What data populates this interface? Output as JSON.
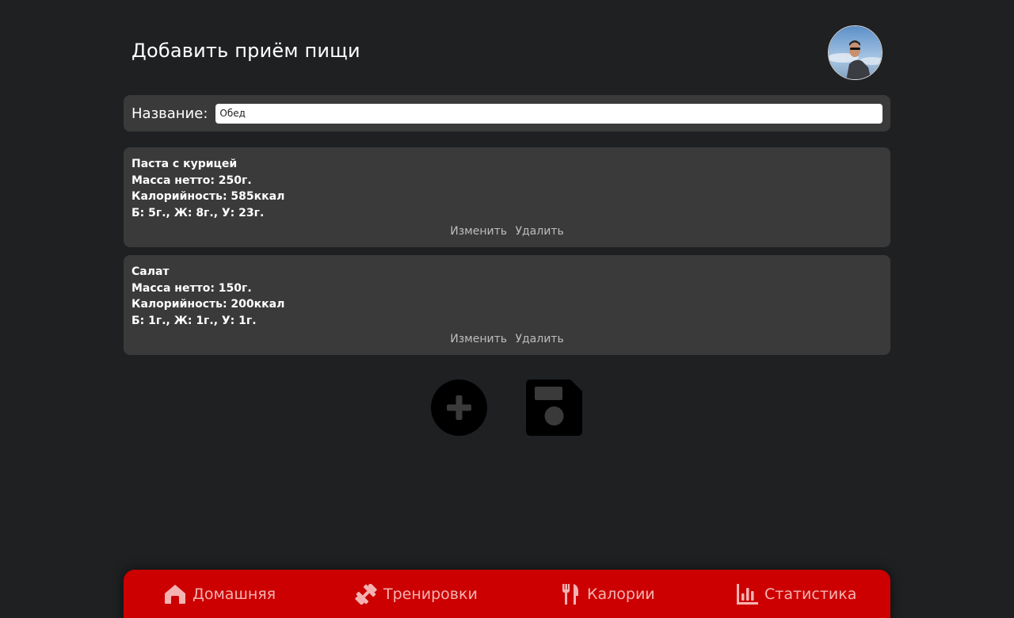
{
  "header": {
    "title": "Добавить приём пищи"
  },
  "name_field": {
    "label": "Название:",
    "value": "Обед"
  },
  "items": [
    {
      "name": "Паста с курицей",
      "mass": "Масса нетто: 250г.",
      "calories": "Калорийность: 585ккал",
      "macros": "Б: 5г., Ж: 8г., У: 23г.",
      "edit_label": "Изменить",
      "delete_label": "Удалить"
    },
    {
      "name": "Салат",
      "mass": "Масса нетто: 150г.",
      "calories": "Калорийность: 200ккал",
      "macros": "Б: 1г., Ж: 1г., У: 1г.",
      "edit_label": "Изменить",
      "delete_label": "Удалить"
    }
  ],
  "actions": {
    "add_icon": "plus-circle-icon",
    "save_icon": "floppy-disk-icon"
  },
  "nav": [
    {
      "label": "Домашняя",
      "icon": "home-icon"
    },
    {
      "label": "Тренировки",
      "icon": "dumbbell-icon"
    },
    {
      "label": "Калории",
      "icon": "fork-knife-icon"
    },
    {
      "label": "Статистика",
      "icon": "bar-chart-icon"
    }
  ],
  "colors": {
    "background": "#1e2022",
    "card": "#3a3a3a",
    "nav_bar": "#cc0000",
    "nav_text": "#f4b3b3",
    "action_link": "#bdbdbd"
  }
}
